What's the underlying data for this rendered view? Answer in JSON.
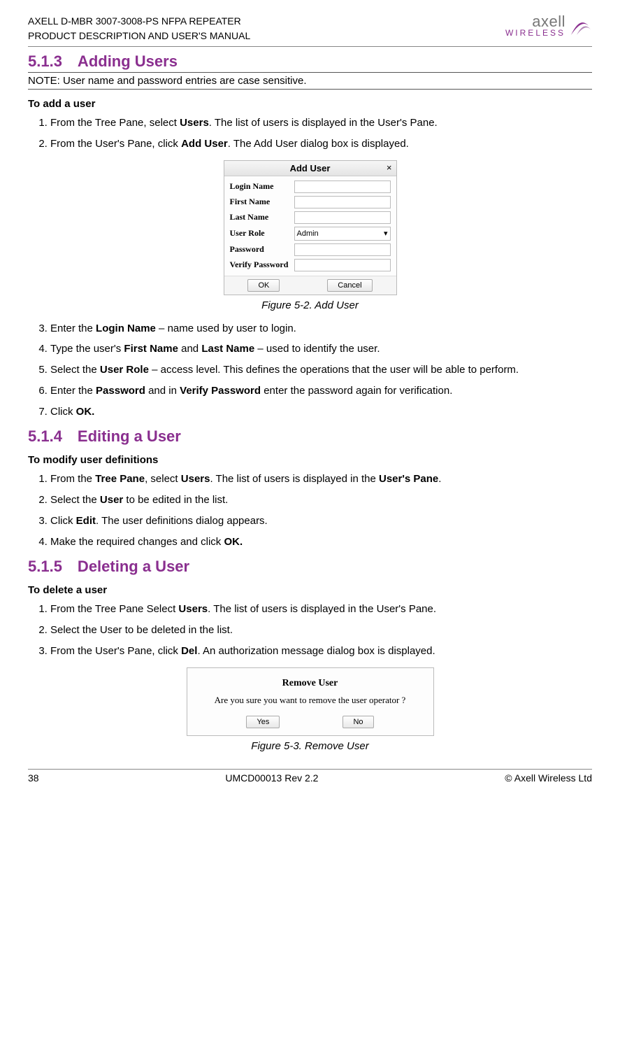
{
  "header": {
    "line1": "AXELL D-MBR 3007-3008-PS NFPA REPEATER",
    "line2": "PRODUCT DESCRIPTION AND USER'S MANUAL",
    "logo_top": "axell",
    "logo_bot": "WIRELESS"
  },
  "sec513": {
    "heading": "5.1.3 Adding Users",
    "note": "NOTE: User name and password entries are case sensitive.",
    "subhead": "To add a user",
    "steps": [
      "From the Tree Pane, select <b>Users</b>. The list of users is displayed in the User's Pane.",
      "From the User's Pane, click <b>Add User</b>. The Add User dialog box is displayed."
    ],
    "steps2": [
      "Enter the <b>Login Name</b> – name used by user to login.",
      "Type the user's <b>First Name</b> and <b>Last Name</b> – used to identify the user.",
      "Select the <b>User Role</b> – access level. This defines the operations that the user will be able to perform.",
      "Enter the <b>Password</b> and in <b>Verify Password</b> enter the password again for verification.",
      "Click <b>OK.</b>"
    ],
    "figcap": "Figure 5-2. Add User",
    "dialog": {
      "title": "Add User",
      "close": "×",
      "labels": {
        "login": "Login Name",
        "first": "First Name",
        "last": "Last Name",
        "role": "User Role",
        "pass": "Password",
        "verify": "Verify Password"
      },
      "role_value": "Admin",
      "ok": "OK",
      "cancel": "Cancel"
    }
  },
  "sec514": {
    "heading": "5.1.4 Editing a User",
    "subhead": "To modify user definitions",
    "steps": [
      "From the <b>Tree Pane</b>, select <b>Users</b>. The list of users is displayed in the <b>User's Pane</b>.",
      "Select the <b>User</b> to be edited in the list.",
      "Click <b>Edit</b>. The user definitions dialog appears.",
      "Make the required changes and click <b>OK.</b>"
    ]
  },
  "sec515": {
    "heading": "5.1.5 Deleting a User",
    "subhead": "To delete a user",
    "steps": [
      "From the Tree Pane Select <b>Users</b>. The list of users is displayed in the User's Pane.",
      "Select the User to be deleted in the list.",
      "From the User's Pane, click <b>Del</b>. An authorization message dialog box is displayed."
    ],
    "figcap": "Figure 5-3. Remove User",
    "dialog": {
      "title": "Remove User",
      "msg": "Are you sure you want to remove the user operator ?",
      "yes": "Yes",
      "no": "No"
    }
  },
  "footer": {
    "left": "38",
    "mid": "UMCD00013 Rev 2.2",
    "right": "© Axell Wireless Ltd"
  }
}
